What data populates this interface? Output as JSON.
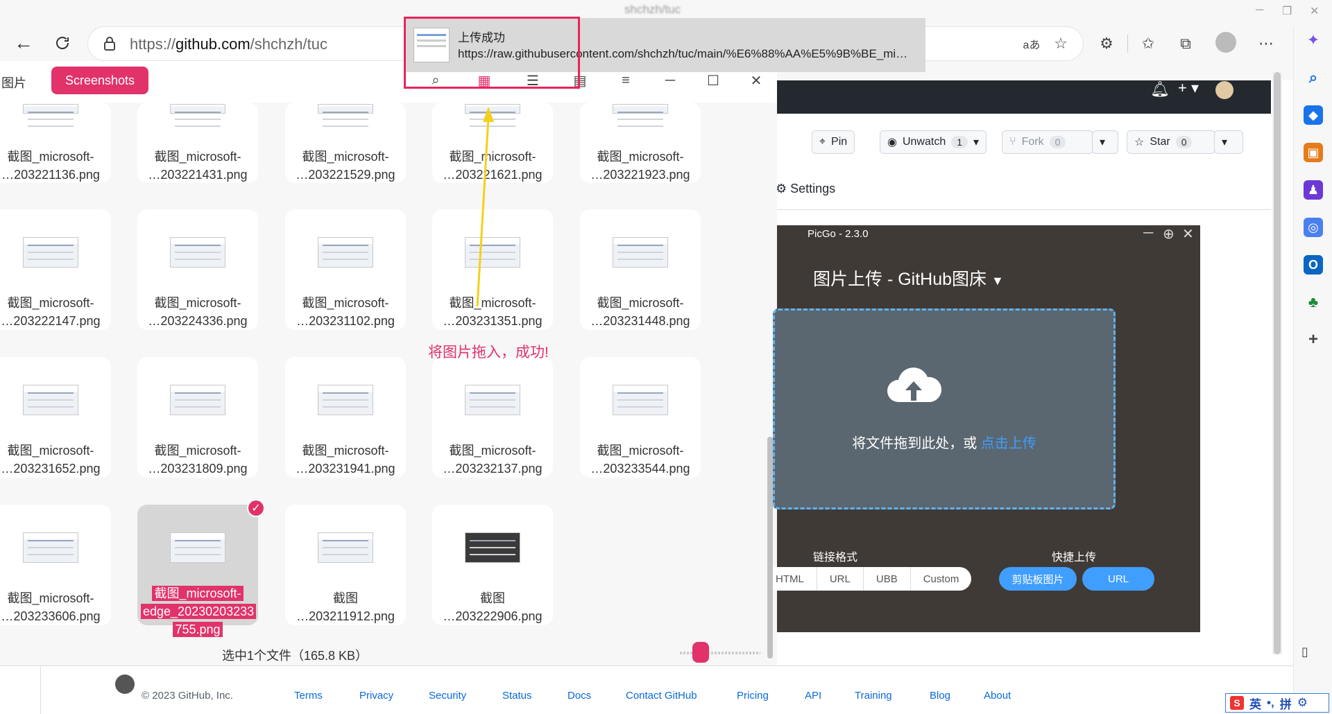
{
  "browser": {
    "window_title": "shchzh/tuc",
    "url_prefix": "https://",
    "url_domain": "github.com",
    "url_path": "/shchzh/tuc"
  },
  "file_browser": {
    "tab_images": "图片",
    "tab_screenshots": "Screenshots",
    "files": [
      {
        "line1": "截图_microsoft-",
        "line2": "…203221136.png"
      },
      {
        "line1": "截图_microsoft-",
        "line2": "…203221431.png"
      },
      {
        "line1": "截图_microsoft-",
        "line2": "…203221529.png"
      },
      {
        "line1": "截图_microsoft-",
        "line2": "…203221621.png"
      },
      {
        "line1": "截图_microsoft-",
        "line2": "…203221923.png"
      },
      {
        "line1": "截图_microsoft-",
        "line2": "…203222147.png"
      },
      {
        "line1": "截图_microsoft-",
        "line2": "…203224336.png"
      },
      {
        "line1": "截图_microsoft-",
        "line2": "…203231102.png"
      },
      {
        "line1": "截图_microsoft-",
        "line2": "…203231351.png"
      },
      {
        "line1": "截图_microsoft-",
        "line2": "…203231448.png"
      },
      {
        "line1": "截图_microsoft-",
        "line2": "…203231652.png"
      },
      {
        "line1": "截图_microsoft-",
        "line2": "…203231809.png"
      },
      {
        "line1": "截图_microsoft-",
        "line2": "…203231941.png"
      },
      {
        "line1": "截图_microsoft-",
        "line2": "…203232137.png"
      },
      {
        "line1": "截图_microsoft-",
        "line2": "…203233544.png"
      },
      {
        "line1": "截图_microsoft-",
        "line2": "…203233606.png"
      },
      {
        "line1": "截图_microsoft-",
        "line2": "edge_20230203233",
        "line3": "755.png",
        "selected": true
      },
      {
        "line1": "截图",
        "line2": "…203211912.png"
      },
      {
        "line1": "截图",
        "line2": "…203222906.png"
      }
    ],
    "status": "选中1个文件（165.8 KB）",
    "accent": "#e1336a"
  },
  "annotation": "将图片拖入，成功!",
  "notification": {
    "title": "上传成功",
    "url": "https://raw.githubusercontent.com/shchzh/tuc/main/%E6%88%AA%E5%9B%BE_mi…"
  },
  "github": {
    "pin": "Pin",
    "unwatch": "Unwatch",
    "unwatch_count": "1",
    "fork": "Fork",
    "fork_count": "0",
    "star": "Star",
    "star_count": "0",
    "settings": "Settings",
    "footer_copy": "© 2023 GitHub, Inc.",
    "footer_links": [
      "Terms",
      "Privacy",
      "Security",
      "Status",
      "Docs",
      "Contact GitHub",
      "Pricing",
      "API",
      "Training",
      "Blog",
      "About"
    ]
  },
  "picgo": {
    "title": "PicGo - 2.3.0",
    "heading": "图片上传 - GitHub图床",
    "drop_text": "将文件拖到此处，或",
    "drop_link": "点击上传",
    "link_format_label": "链接格式",
    "quick_upload_label": "快捷上传",
    "formats": [
      "HTML",
      "URL",
      "UBB",
      "Custom"
    ],
    "clipboard_button": "剪贴板图片",
    "url_button": "URL",
    "accent": "#409eff"
  },
  "ime": {
    "lang": "英",
    "mode": "拼"
  }
}
